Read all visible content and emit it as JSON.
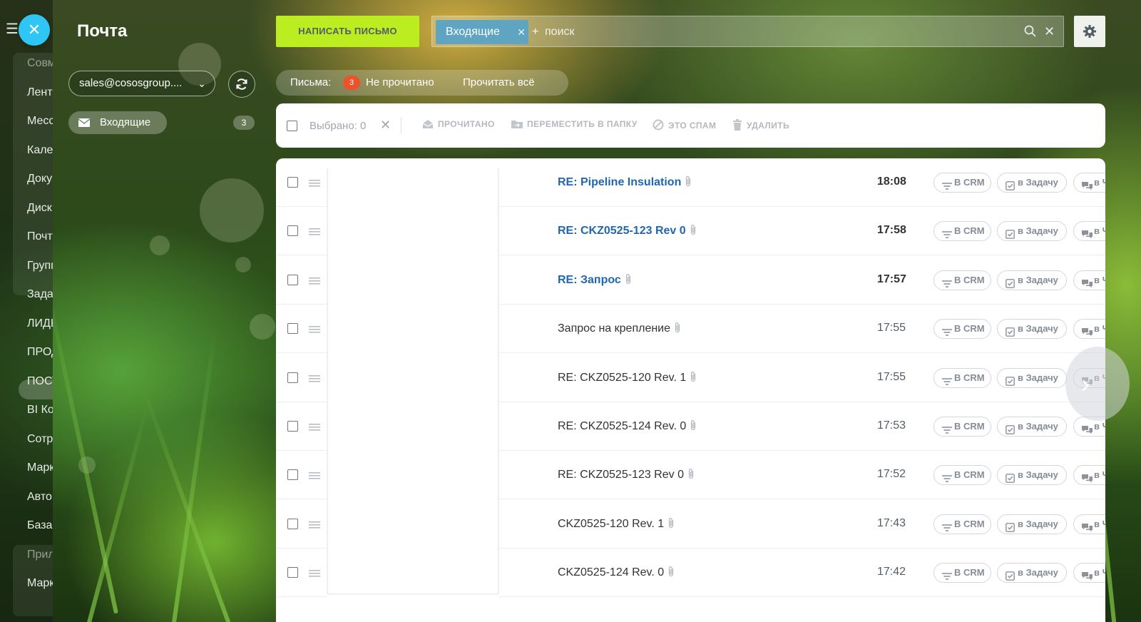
{
  "app_menu": {
    "items": [
      {
        "label": "Совместные",
        "muted": true
      },
      {
        "label": "Лента",
        "muted": false
      },
      {
        "label": "Мессенджер",
        "muted": false
      },
      {
        "label": "Календарь",
        "muted": false
      },
      {
        "label": "Документы",
        "muted": false
      },
      {
        "label": "Диск",
        "muted": false
      },
      {
        "label": "Почта",
        "muted": false
      },
      {
        "label": "Группы",
        "muted": false
      },
      {
        "label": "Задачи",
        "muted": false
      },
      {
        "label": "ЛИДЫ",
        "muted": false
      },
      {
        "label": "ПРОДАЖИ",
        "muted": false
      },
      {
        "label": "ПОСТАВКИ",
        "muted": false
      },
      {
        "label": "BI Конструктор",
        "muted": false
      },
      {
        "label": "Сотрудники",
        "muted": false
      },
      {
        "label": "Маркетинг",
        "muted": false
      },
      {
        "label": "Автоматизация",
        "muted": false
      },
      {
        "label": "База знаний",
        "muted": false
      },
      {
        "label": "Приложения",
        "muted": true
      },
      {
        "label": "Маркет",
        "muted": false
      }
    ]
  },
  "sidebar": {
    "title": "Почта",
    "mailbox": "sales@cososgroup....",
    "folders": [
      {
        "label": "Входящие",
        "count": "3"
      }
    ]
  },
  "toolbar": {
    "compose_label": "НАПИСАТЬ ПИСЬМО",
    "filter_chip": "Входящие",
    "search_placeholder": "поиск",
    "search_plus": "+"
  },
  "counters": {
    "label": "Письма:",
    "unread_count": "3",
    "unread_label": "Не прочитано",
    "read_all_label": "Прочитать всё"
  },
  "actions": {
    "selected_label": "Выбрано: 0",
    "read": "ПРОЧИТАНО",
    "move": "ПЕРЕМЕСТИТЬ В ПАПКУ",
    "spam": "ЭТО СПАМ",
    "delete": "УДАЛИТЬ"
  },
  "messages": [
    {
      "subject": "RE: Pipeline Insulation",
      "time": "18:08",
      "unread": true
    },
    {
      "subject": "RE: CKZ0525-123 Rev 0",
      "time": "17:58",
      "unread": true
    },
    {
      "subject": "RE: Запрос",
      "time": "17:57",
      "unread": true
    },
    {
      "subject": "Запрос на крепление",
      "time": "17:55",
      "unread": false
    },
    {
      "subject": "RE: CKZ0525-120 Rev. 1",
      "time": "17:55",
      "unread": false
    },
    {
      "subject": "RE: CKZ0525-124 Rev. 0",
      "time": "17:53",
      "unread": false
    },
    {
      "subject": "RE: CKZ0525-123 Rev 0",
      "time": "17:52",
      "unread": false
    },
    {
      "subject": "CKZ0525-120 Rev. 1",
      "time": "17:43",
      "unread": false
    },
    {
      "subject": "CKZ0525-124 Rev. 0",
      "time": "17:42",
      "unread": false
    }
  ],
  "row_actions": {
    "crm": "В CRM",
    "task": "в Задачу",
    "chat": "в Ч"
  },
  "colors": {
    "accent_blue": "#2fc6f6",
    "compose_green": "#bbed21",
    "chip_blue": "#5fa5c2",
    "unread_badge": "#f0512d",
    "unread_subject": "#2067b0"
  }
}
